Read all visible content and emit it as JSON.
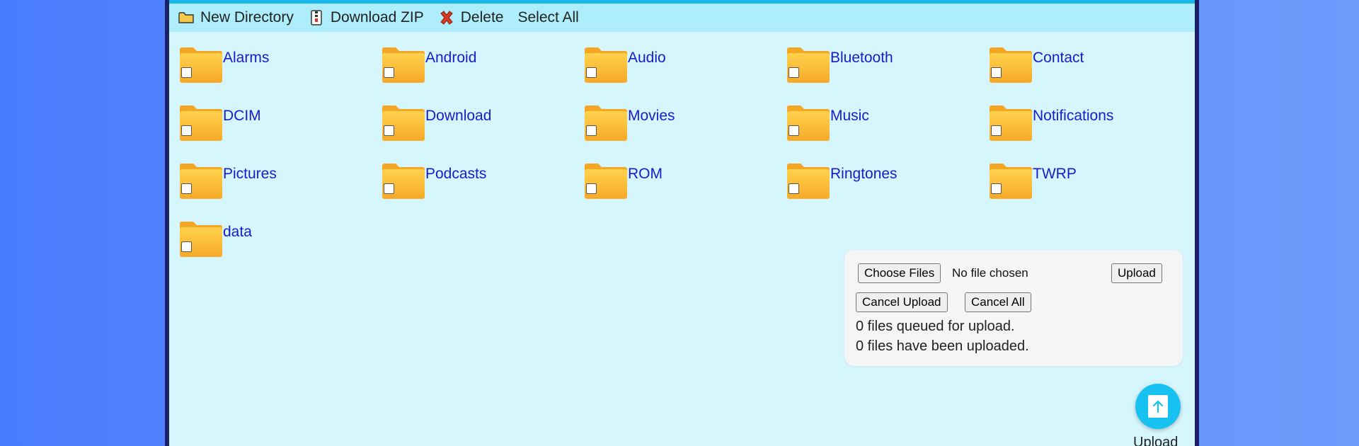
{
  "toolbar": {
    "new_directory": "New Directory",
    "download_zip": "Download ZIP",
    "delete": "Delete",
    "select_all": "Select All",
    "icons": [
      "folder-icon",
      "zip-icon",
      "delete-x-icon"
    ]
  },
  "folders": [
    {
      "name": "Alarms",
      "checked": false
    },
    {
      "name": "Android",
      "checked": false
    },
    {
      "name": "Audio",
      "checked": false
    },
    {
      "name": "Bluetooth",
      "checked": false
    },
    {
      "name": "Contact",
      "checked": false
    },
    {
      "name": "DCIM",
      "checked": false
    },
    {
      "name": "Download",
      "checked": false
    },
    {
      "name": "Movies",
      "checked": false
    },
    {
      "name": "Music",
      "checked": false
    },
    {
      "name": "Notifications",
      "checked": false
    },
    {
      "name": "Pictures",
      "checked": false
    },
    {
      "name": "Podcasts",
      "checked": false
    },
    {
      "name": "ROM",
      "checked": false
    },
    {
      "name": "Ringtones",
      "checked": false
    },
    {
      "name": "TWRP",
      "checked": false
    },
    {
      "name": "data",
      "checked": false
    }
  ],
  "upload_panel": {
    "choose_files": "Choose Files",
    "no_file": "No file chosen",
    "upload": "Upload",
    "cancel_upload": "Cancel Upload",
    "cancel_all": "Cancel All",
    "queued_status": "0 files queued for upload.",
    "uploaded_status": "0 files have been uploaded."
  },
  "fab": {
    "label": "Upload",
    "icon": "upload-arrow-icon"
  },
  "colors": {
    "background": "#4a7cff",
    "panel": "#d6f6fd",
    "toolbar": "#aeedfb",
    "accent": "#17c2f0",
    "link": "#1a1acc",
    "border": "#1b2166"
  }
}
